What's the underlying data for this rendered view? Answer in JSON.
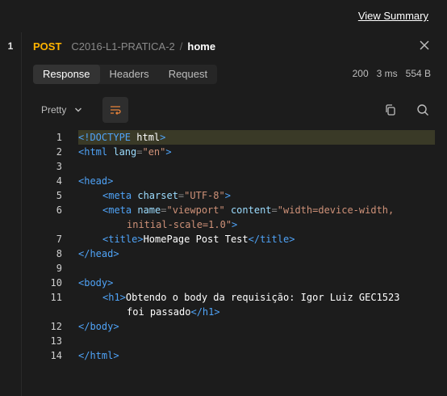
{
  "header": {
    "view_summary": "View Summary"
  },
  "sidebar": {
    "request_number": "1"
  },
  "request": {
    "method": "POST",
    "collection": "C2016-L1-PRATICA-2",
    "separator": "/",
    "name": "home"
  },
  "tabs": [
    "Response",
    "Headers",
    "Request"
  ],
  "active_tab": "Response",
  "stats": {
    "status": "200",
    "time": "3 ms",
    "size": "554 B"
  },
  "toolbar": {
    "format": "Pretty"
  },
  "icons": [
    "close-icon",
    "chevron-down-icon",
    "wrap-lines-icon",
    "copy-icon",
    "search-icon"
  ],
  "colors": {
    "method": "#ffb400",
    "tag": "#4fa3f7",
    "string": "#ce9178",
    "highlight": "#3a3a27"
  },
  "code_lines": [
    {
      "n": "1",
      "parts": [
        [
          "tag",
          "<!DOCTYPE"
        ],
        [
          "txt",
          " html"
        ],
        [
          "tag",
          ">"
        ]
      ]
    },
    {
      "n": "2",
      "parts": [
        [
          "tag",
          "<html"
        ],
        [
          "attr",
          " lang"
        ],
        [
          "punc",
          "="
        ],
        [
          "str",
          "\"en\""
        ],
        [
          "tag",
          ">"
        ]
      ]
    },
    {
      "n": "3",
      "parts": []
    },
    {
      "n": "4",
      "parts": [
        [
          "tag",
          "<head>"
        ]
      ]
    },
    {
      "n": "5",
      "indent": 1,
      "parts": [
        [
          "tag",
          "<meta"
        ],
        [
          "attr",
          " charset"
        ],
        [
          "punc",
          "="
        ],
        [
          "str",
          "\"UTF-8\""
        ],
        [
          "tag",
          ">"
        ]
      ]
    },
    {
      "n": "6",
      "indent": 1,
      "parts": [
        [
          "tag",
          "<meta"
        ],
        [
          "attr",
          " name"
        ],
        [
          "punc",
          "="
        ],
        [
          "str",
          "\"viewport\""
        ],
        [
          "attr",
          " content"
        ],
        [
          "punc",
          "="
        ],
        [
          "str",
          "\"width=device-width,"
        ]
      ]
    },
    {
      "n": "",
      "indent": 2,
      "parts": [
        [
          "str",
          "initial-scale=1.0\""
        ],
        [
          "tag",
          ">"
        ]
      ]
    },
    {
      "n": "7",
      "indent": 1,
      "parts": [
        [
          "tag",
          "<title>"
        ],
        [
          "txt",
          "HomePage Post Test"
        ],
        [
          "tag",
          "</title>"
        ]
      ]
    },
    {
      "n": "8",
      "parts": [
        [
          "tag",
          "</head>"
        ]
      ]
    },
    {
      "n": "9",
      "parts": []
    },
    {
      "n": "10",
      "parts": [
        [
          "tag",
          "<body>"
        ]
      ]
    },
    {
      "n": "11",
      "indent": 1,
      "parts": [
        [
          "tag",
          "<h1>"
        ],
        [
          "txt",
          "Obtendo o body da requisição: Igor Luiz GEC1523"
        ]
      ]
    },
    {
      "n": "",
      "indent": 2,
      "parts": [
        [
          "txt",
          "foi passado"
        ],
        [
          "tag",
          "</h1>"
        ]
      ]
    },
    {
      "n": "12",
      "parts": [
        [
          "tag",
          "</body>"
        ]
      ]
    },
    {
      "n": "13",
      "parts": []
    },
    {
      "n": "14",
      "parts": [
        [
          "tag",
          "</html>"
        ]
      ]
    }
  ]
}
